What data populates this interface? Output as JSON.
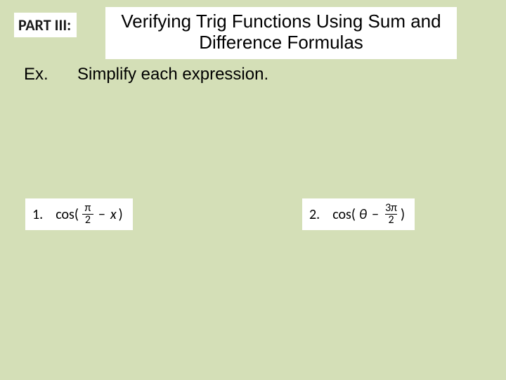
{
  "header": {
    "part_label": "PART III:",
    "title": "Verifying Trig Functions Using Sum and Difference Formulas"
  },
  "example": {
    "label": "Ex.",
    "instruction": "Simplify each expression."
  },
  "problems": [
    {
      "number": "1.",
      "func": "cos(",
      "frac_num": "π",
      "frac_den": "2",
      "middle_op": "−",
      "var": "x",
      "close": ")"
    },
    {
      "number": "2.",
      "func": "cos(",
      "var": "θ",
      "middle_op": "−",
      "frac_num": "3π",
      "frac_den": "2",
      "close": ")"
    }
  ]
}
